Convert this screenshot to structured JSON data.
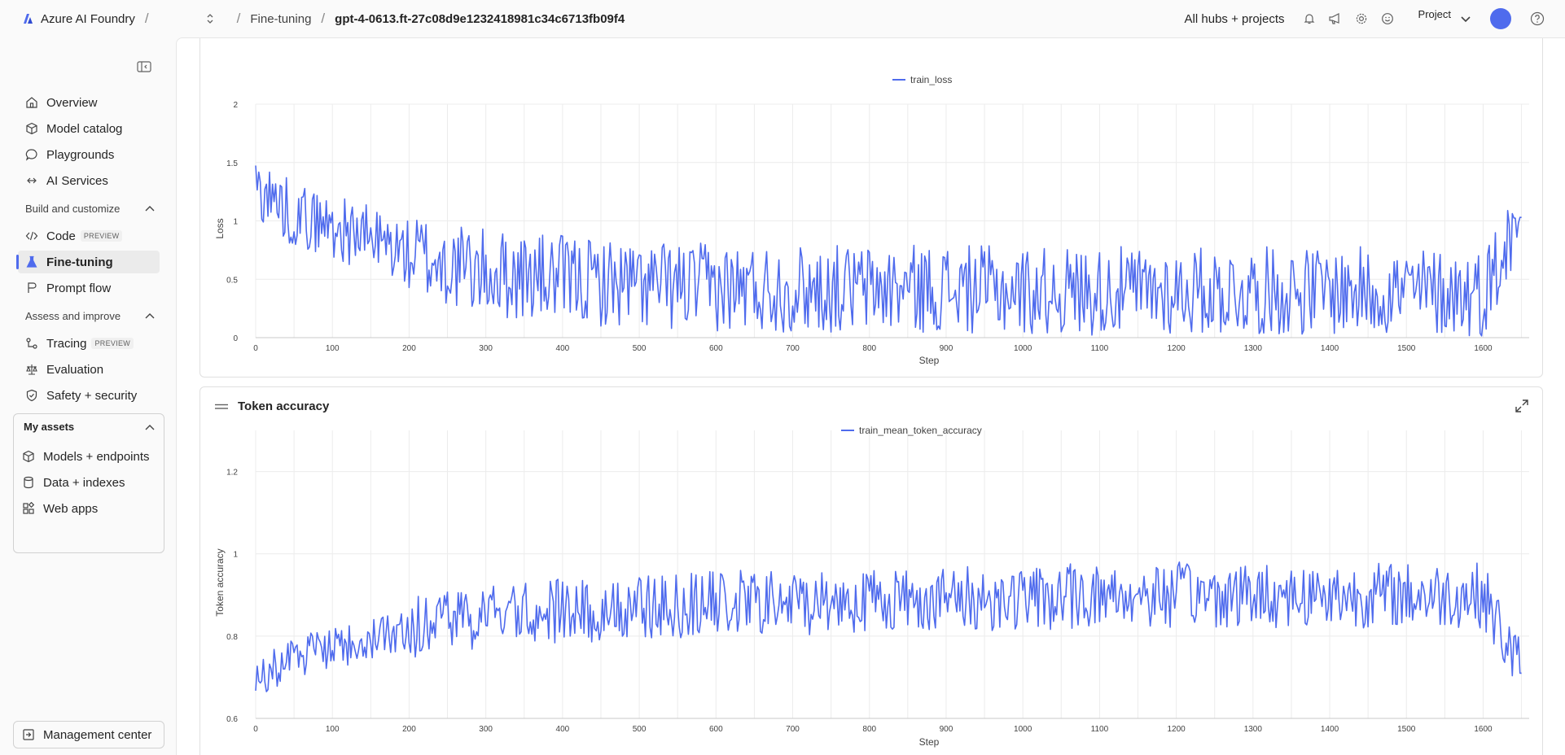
{
  "header": {
    "brand": "Azure AI Foundry",
    "breadcrumbs": [
      "Fine-tuning",
      "gpt-4-0613.ft-27c08d9e1232418981c34c6713fb09f4"
    ],
    "hubs": "All hubs + projects",
    "project": "Project",
    "icons": [
      "bell-icon",
      "megaphone-icon",
      "gear-icon",
      "smiley-icon",
      "chevron-down-icon",
      "help-icon"
    ]
  },
  "sidebar": {
    "top_items": [
      {
        "label": "Overview",
        "icon": "home-icon"
      },
      {
        "label": "Model catalog",
        "icon": "cube-icon"
      },
      {
        "label": "Playgrounds",
        "icon": "chat-icon"
      },
      {
        "label": "AI Services",
        "icon": "link-icon"
      }
    ],
    "section_build": "Build and customize",
    "build_items": [
      {
        "label": "Code",
        "badge": "PREVIEW",
        "icon": "code-icon"
      },
      {
        "label": "Fine-tuning",
        "icon": "flask-icon",
        "active": true
      },
      {
        "label": "Prompt flow",
        "icon": "flow-icon"
      }
    ],
    "section_assess": "Assess and improve",
    "assess_items": [
      {
        "label": "Tracing",
        "badge": "PREVIEW",
        "icon": "tracing-icon"
      },
      {
        "label": "Evaluation",
        "icon": "scale-icon"
      },
      {
        "label": "Safety + security",
        "icon": "shield-icon"
      }
    ],
    "assets_title": "My assets",
    "asset_items": [
      {
        "label": "Models + endpoints",
        "icon": "cube-icon"
      },
      {
        "label": "Data + indexes",
        "icon": "database-icon"
      },
      {
        "label": "Web apps",
        "icon": "apps-icon"
      }
    ],
    "management": "Management center"
  },
  "charts": {
    "loss": {
      "legend": "train_loss",
      "xlabel": "Step",
      "ylabel": "Loss",
      "yticks": [
        "0",
        "0.5",
        "1",
        "1.5",
        "2"
      ],
      "xticks": [
        "0",
        "100",
        "200",
        "300",
        "400",
        "500",
        "600",
        "700",
        "800",
        "900",
        "1000",
        "1100",
        "1200",
        "1300",
        "1400",
        "1500",
        "1600"
      ]
    },
    "accuracy": {
      "title": "Token accuracy",
      "legend": "train_mean_token_accuracy",
      "xlabel": "Step",
      "ylabel": "Token accuracy",
      "yticks": [
        "0.6",
        "0.8",
        "1",
        "1.2"
      ],
      "xticks": [
        "0",
        "100",
        "200",
        "300",
        "400",
        "500",
        "600",
        "700",
        "800",
        "900",
        "1000",
        "1100",
        "1200",
        "1300",
        "1400",
        "1500",
        "1600"
      ]
    }
  },
  "chart_data": [
    {
      "type": "line",
      "title": "",
      "xlabel": "Step",
      "ylabel": "Loss",
      "xlim": [
        0,
        1660
      ],
      "ylim": [
        0,
        2
      ],
      "grid": true,
      "legend": "top-center",
      "series": [
        {
          "name": "train_loss",
          "color": "#4f6bed",
          "x": [
            0,
            20,
            50,
            100,
            150,
            200,
            250,
            300,
            400,
            500,
            600,
            700,
            800,
            900,
            1000,
            1100,
            1200,
            1300,
            1400,
            1500,
            1600,
            1650
          ],
          "y": [
            1.3,
            1.2,
            1.05,
            0.95,
            0.85,
            0.72,
            0.62,
            0.55,
            0.5,
            0.45,
            0.43,
            0.42,
            0.42,
            0.42,
            0.4,
            0.4,
            0.4,
            0.4,
            0.4,
            0.4,
            0.38,
            1.03
          ]
        }
      ]
    },
    {
      "type": "line",
      "title": "Token accuracy",
      "xlabel": "Step",
      "ylabel": "Token accuracy",
      "xlim": [
        0,
        1660
      ],
      "ylim": [
        0.6,
        1.3
      ],
      "grid": true,
      "legend": "top-center",
      "series": [
        {
          "name": "train_mean_token_accuracy",
          "color": "#4f6bed",
          "x": [
            0,
            20,
            50,
            100,
            150,
            200,
            250,
            300,
            400,
            500,
            600,
            700,
            800,
            900,
            1000,
            1100,
            1200,
            1300,
            1400,
            1500,
            1600,
            1650
          ],
          "y": [
            0.7,
            0.72,
            0.75,
            0.77,
            0.79,
            0.82,
            0.84,
            0.85,
            0.86,
            0.87,
            0.88,
            0.88,
            0.89,
            0.89,
            0.89,
            0.9,
            0.9,
            0.9,
            0.9,
            0.9,
            0.9,
            0.71
          ]
        }
      ]
    }
  ]
}
